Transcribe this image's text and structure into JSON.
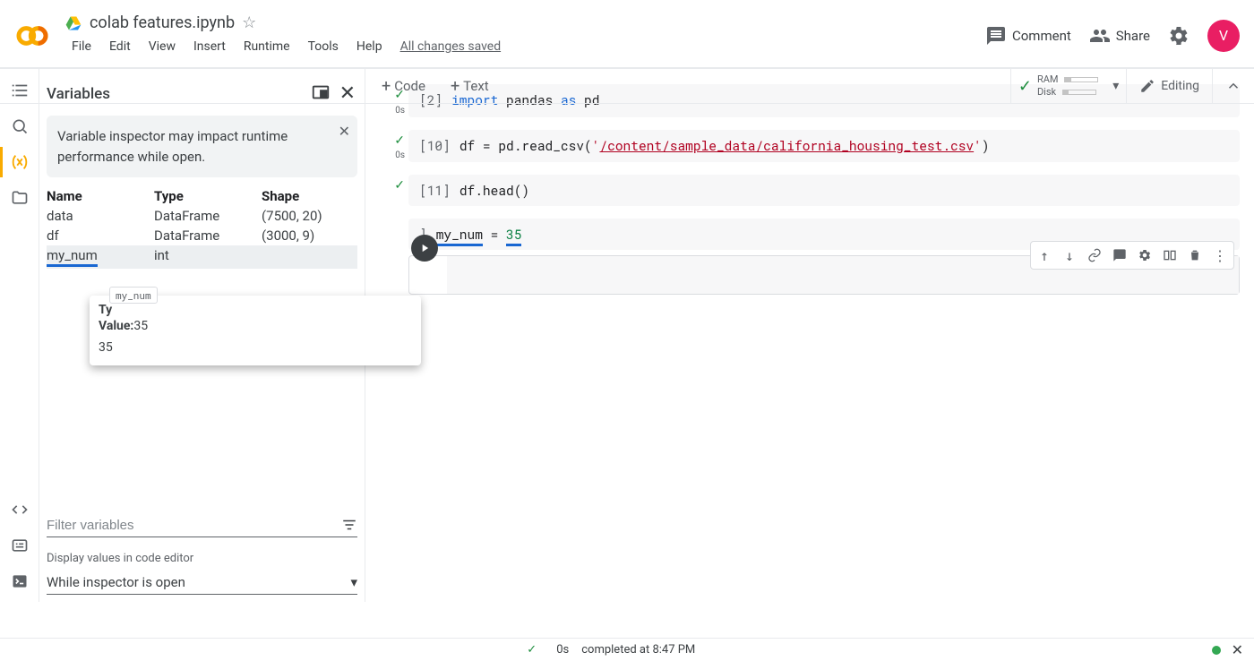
{
  "header": {
    "title": "colab features.ipynb",
    "menus": [
      "File",
      "Edit",
      "View",
      "Insert",
      "Runtime",
      "Tools",
      "Help"
    ],
    "saved": "All changes saved",
    "comment": "Comment",
    "share": "Share",
    "avatar": "V"
  },
  "toolbar": {
    "code": "Code",
    "text": "Text",
    "ram": "RAM",
    "disk": "Disk",
    "editing": "Editing"
  },
  "variables": {
    "title": "Variables",
    "warning": "Variable inspector may impact runtime performance while open.",
    "columns": [
      "Name",
      "Type",
      "Shape"
    ],
    "rows": [
      {
        "name": "data",
        "type": "DataFrame",
        "shape": "(7500, 20)"
      },
      {
        "name": "df",
        "type": "DataFrame",
        "shape": "(3000, 9)"
      },
      {
        "name": "my_num",
        "type": "int",
        "shape": ""
      }
    ],
    "tooltip": {
      "chip": "my_num",
      "type_label": "Ty",
      "value_label": "Value:",
      "value": "35",
      "content": "35"
    },
    "filter_placeholder": "Filter variables",
    "display_label": "Display values in code editor",
    "display_select": "While inspector is open"
  },
  "cells": [
    {
      "num": "[2]",
      "time": "0s",
      "code_parts": [
        {
          "t": "import",
          "c": "kw"
        },
        {
          "t": " pandas ",
          "c": ""
        },
        {
          "t": "as",
          "c": "kw"
        },
        {
          "t": " pd",
          "c": ""
        }
      ]
    },
    {
      "num": "[10]",
      "time": "0s",
      "code_parts": [
        {
          "t": "df = pd.read_csv(",
          "c": ""
        },
        {
          "t": "'",
          "c": "str"
        },
        {
          "t": "/content/sample_data/california_housing_test.csv",
          "c": "str-path"
        },
        {
          "t": "'",
          "c": "str"
        },
        {
          "t": ")",
          "c": ""
        }
      ]
    },
    {
      "num": "[11]",
      "time": "",
      "code_parts": [
        {
          "t": "df.head()",
          "c": ""
        }
      ]
    },
    {
      "num": "]",
      "time": "",
      "code_parts": [
        {
          "t": "my_num",
          "c": "code-underline"
        },
        {
          "t": " = ",
          "c": ""
        },
        {
          "t": "35",
          "c": "num-lit code-underline"
        }
      ]
    }
  ],
  "statusbar": {
    "time": "0s",
    "text": "completed at 8:47 PM"
  }
}
